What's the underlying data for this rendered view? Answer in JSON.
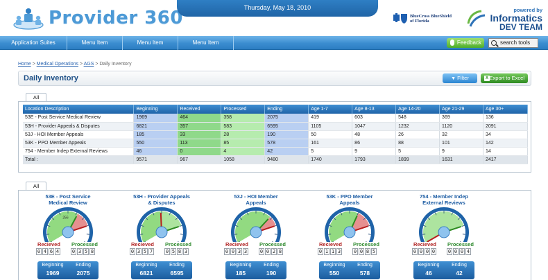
{
  "header": {
    "app_title": "Provider 360°",
    "date": "Thursday, May 18, 2010",
    "bcbs_text": "BlueCross BlueShield of Florida",
    "powered_by": "powered by",
    "team_name": "Informatics",
    "team_sub": "DEV TEAM"
  },
  "nav": {
    "items": [
      "Application Suites",
      "Menu Item",
      "Menu Item",
      "Menu Item"
    ],
    "feedback_label": "Feedback",
    "search_placeholder": "search tools"
  },
  "breadcrumb": {
    "items": [
      "Home",
      "Medical Operations",
      "AGS"
    ],
    "current": "Daily Inventory"
  },
  "page": {
    "title": "Daily Inventory",
    "filter_label": "Filter",
    "export_label": "Export to Excel",
    "tab_label": "All"
  },
  "table": {
    "headers": [
      "Location Description",
      "Beginning",
      "Received",
      "Processed",
      "Ending",
      "Age 1-7",
      "Age 8-13",
      "Age 14-20",
      "Age 21-29",
      "Age 30+"
    ],
    "rows": [
      [
        "53E - Post Service Medical Review",
        "1969",
        "464",
        "358",
        "2075",
        "419",
        "603",
        "548",
        "369",
        "136"
      ],
      [
        "53H - Provider Appeals & Disputes",
        "6821",
        "357",
        "583",
        "6595",
        "1105",
        "1047",
        "1232",
        "1120",
        "2091"
      ],
      [
        "53J - HOI Member Appeals",
        "185",
        "33",
        "28",
        "190",
        "50",
        "48",
        "26",
        "32",
        "34"
      ],
      [
        "53K - PPO Member Appeals",
        "550",
        "113",
        "85",
        "578",
        "161",
        "86",
        "88",
        "101",
        "142"
      ],
      [
        "754 - Member Indep External Reviews",
        "46",
        "0",
        "4",
        "42",
        "5",
        "9",
        "5",
        "9",
        "14"
      ]
    ],
    "total": [
      "Total :",
      "9571",
      "967",
      "1058",
      "9480",
      "1740",
      "1793",
      "1899",
      "1631",
      "2417"
    ]
  },
  "gauges_tab_label": "All",
  "gauge_labels": {
    "received": "Recieved",
    "processed": "Processed",
    "beginning": "Beginning",
    "ending": "Ending"
  },
  "gauges": [
    {
      "title_1": "53E - Post Service",
      "title_2": "Medical Review",
      "max_label": "256",
      "received": 464,
      "processed": 358,
      "received_digits": [
        "0",
        "4",
        "6",
        "4"
      ],
      "processed_digits": [
        "0",
        "3",
        "5",
        "8"
      ],
      "beginning": "1969",
      "ending": "2075"
    },
    {
      "title_1": "53H - Provider Appeals",
      "title_2": "& Disputes",
      "max_label": "",
      "received": 357,
      "processed": 583,
      "received_digits": [
        "0",
        "3",
        "5",
        "7"
      ],
      "processed_digits": [
        "0",
        "5",
        "8",
        "3"
      ],
      "beginning": "6821",
      "ending": "6595"
    },
    {
      "title_1": "53J - HOI Member",
      "title_2": "Appeals",
      "max_label": "",
      "received": 33,
      "processed": 28,
      "received_digits": [
        "0",
        "0",
        "3",
        "3"
      ],
      "processed_digits": [
        "0",
        "0",
        "2",
        "8"
      ],
      "beginning": "185",
      "ending": "190"
    },
    {
      "title_1": "53K - PPO Member",
      "title_2": "Appeals",
      "max_label": "",
      "received": 113,
      "processed": 85,
      "received_digits": [
        "0",
        "1",
        "1",
        "3"
      ],
      "processed_digits": [
        "0",
        "0",
        "8",
        "5"
      ],
      "beginning": "550",
      "ending": "578"
    },
    {
      "title_1": "754 - Member Indep",
      "title_2": "External Reviews",
      "max_label": "",
      "received": 0,
      "processed": 4,
      "received_digits": [
        "0",
        "0",
        "0",
        "0"
      ],
      "processed_digits": [
        "0",
        "0",
        "0",
        "4"
      ],
      "beginning": "46",
      "ending": "42"
    }
  ],
  "colors": {
    "brand_blue": "#4d9ad6",
    "nav_blue": "#2c7dc2",
    "received_red": "#d43b3b",
    "processed_green": "#7fd36b",
    "beginning_blue": "#b9cff2"
  }
}
